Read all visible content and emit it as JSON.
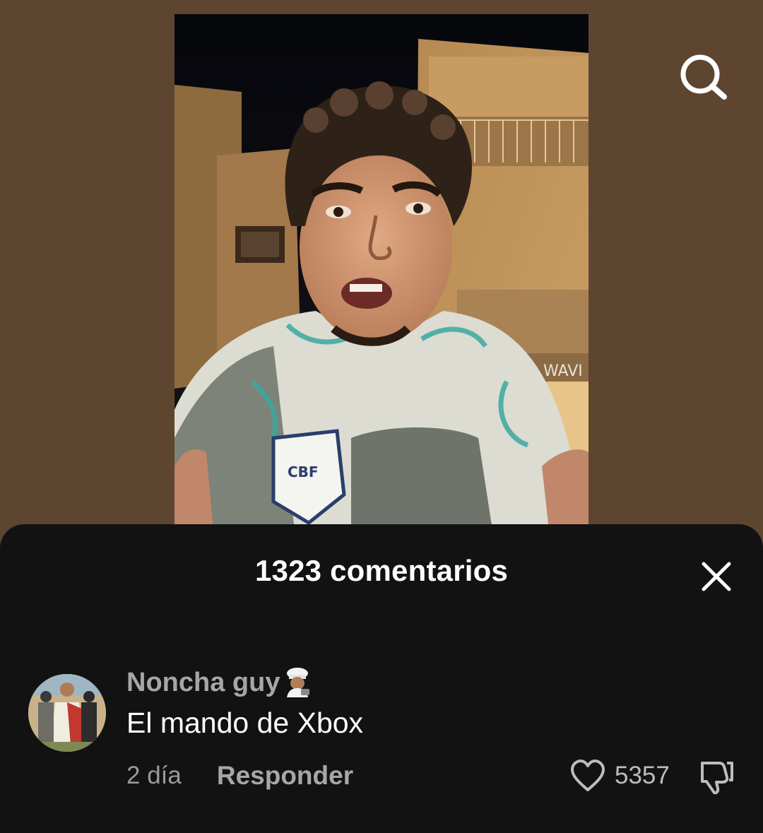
{
  "app": {
    "background_color": "#5e4530",
    "sheet_color": "#121212"
  },
  "video": {
    "jersey_badge_text": "CBF",
    "shop_sign_text": "WAVI"
  },
  "header": {
    "search_icon": "search-icon"
  },
  "comments_sheet": {
    "title": "1323 comentarios",
    "close_icon": "close-icon"
  },
  "comments": [
    {
      "username": "Noncha guy",
      "username_emoji": "chef-emoji",
      "text": "El mando de Xbox",
      "date": "2 día",
      "reply_label": "Responder",
      "like_count": "5357",
      "like_icon": "heart-icon",
      "dislike_icon": "thumbs-down-icon"
    }
  ]
}
